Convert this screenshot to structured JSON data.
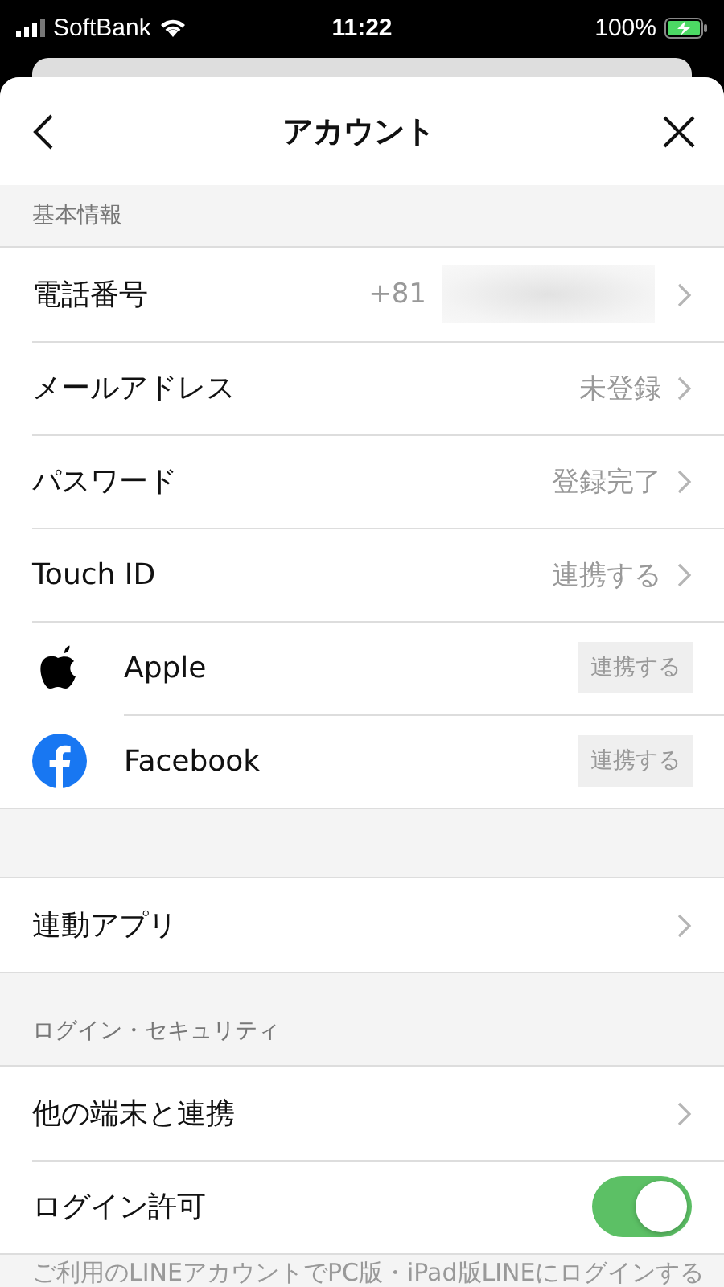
{
  "status_bar": {
    "carrier": "SoftBank",
    "time": "11:22",
    "battery": "100%"
  },
  "header": {
    "title": "アカウント"
  },
  "sections": [
    {
      "label": "基本情報",
      "rows": [
        {
          "kind": "link",
          "label": "電話番号",
          "value": "+81",
          "redacted": true
        },
        {
          "kind": "link",
          "label": "メールアドレス",
          "value": "未登録"
        },
        {
          "kind": "link",
          "label": "パスワード",
          "value": "登録完了"
        },
        {
          "kind": "link",
          "label": "Touch ID",
          "value": "連携する"
        },
        {
          "kind": "social",
          "label": "Apple",
          "button": "連携する"
        },
        {
          "kind": "social",
          "label": "Facebook",
          "button": "連携する"
        }
      ]
    },
    {
      "rows": [
        {
          "kind": "link",
          "label": "連動アプリ"
        }
      ]
    },
    {
      "label": "ログイン・セキュリティ",
      "rows": [
        {
          "kind": "link",
          "label": "他の端末と連携"
        },
        {
          "kind": "toggle",
          "label": "ログイン許可",
          "on": true
        }
      ]
    }
  ],
  "footer": "ご利用のLINEアカウントでPC版・iPad版LINEにログインする"
}
